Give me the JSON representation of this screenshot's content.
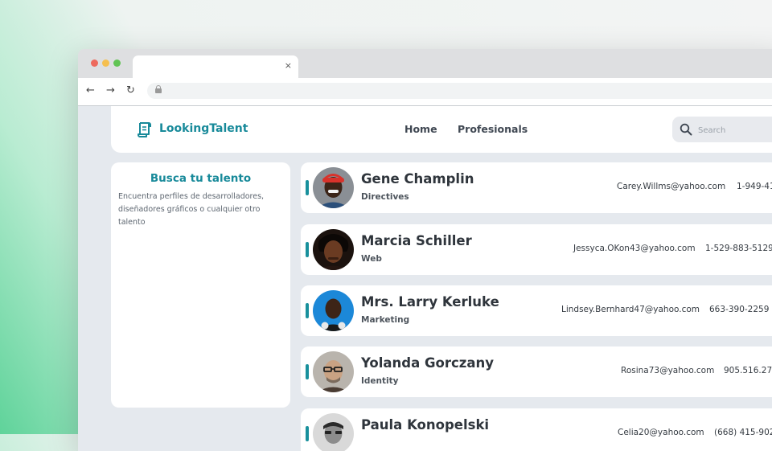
{
  "browser": {
    "tab_close": "×",
    "nav_back": "←",
    "nav_forward": "→",
    "nav_reload": "↻",
    "url": ""
  },
  "header": {
    "logo": "LookingTalent",
    "nav": [
      "Home",
      "Profesionals"
    ],
    "search_placeholder": "Search"
  },
  "sidebar": {
    "title": "Busca tu talento",
    "description": "Encuentra perfiles de desarrolladores, diseñadores gráficos o cualquier otro talento"
  },
  "profiles": [
    {
      "name": "Gene Champlin",
      "role": "Directives",
      "email": "Carey.Willms@yahoo.com",
      "phone": "1-949-41"
    },
    {
      "name": "Marcia Schiller",
      "role": "Web",
      "email": "Jessyca.OKon43@yahoo.com",
      "phone": "1-529-883-5129"
    },
    {
      "name": "Mrs. Larry Kerluke",
      "role": "Marketing",
      "email": "Lindsey.Bernhard47@yahoo.com",
      "phone": "663-390-2259"
    },
    {
      "name": "Yolanda Gorczany",
      "role": "Identity",
      "email": "Rosina73@yahoo.com",
      "phone": "905.516.27"
    },
    {
      "name": "Paula Konopelski",
      "role": "",
      "email": "Celia20@yahoo.com",
      "phone": "(668) 415-902"
    }
  ],
  "colors": {
    "accent": "#188a9a",
    "card_accent": "#18909c",
    "page_bg": "#e5e9ee"
  }
}
